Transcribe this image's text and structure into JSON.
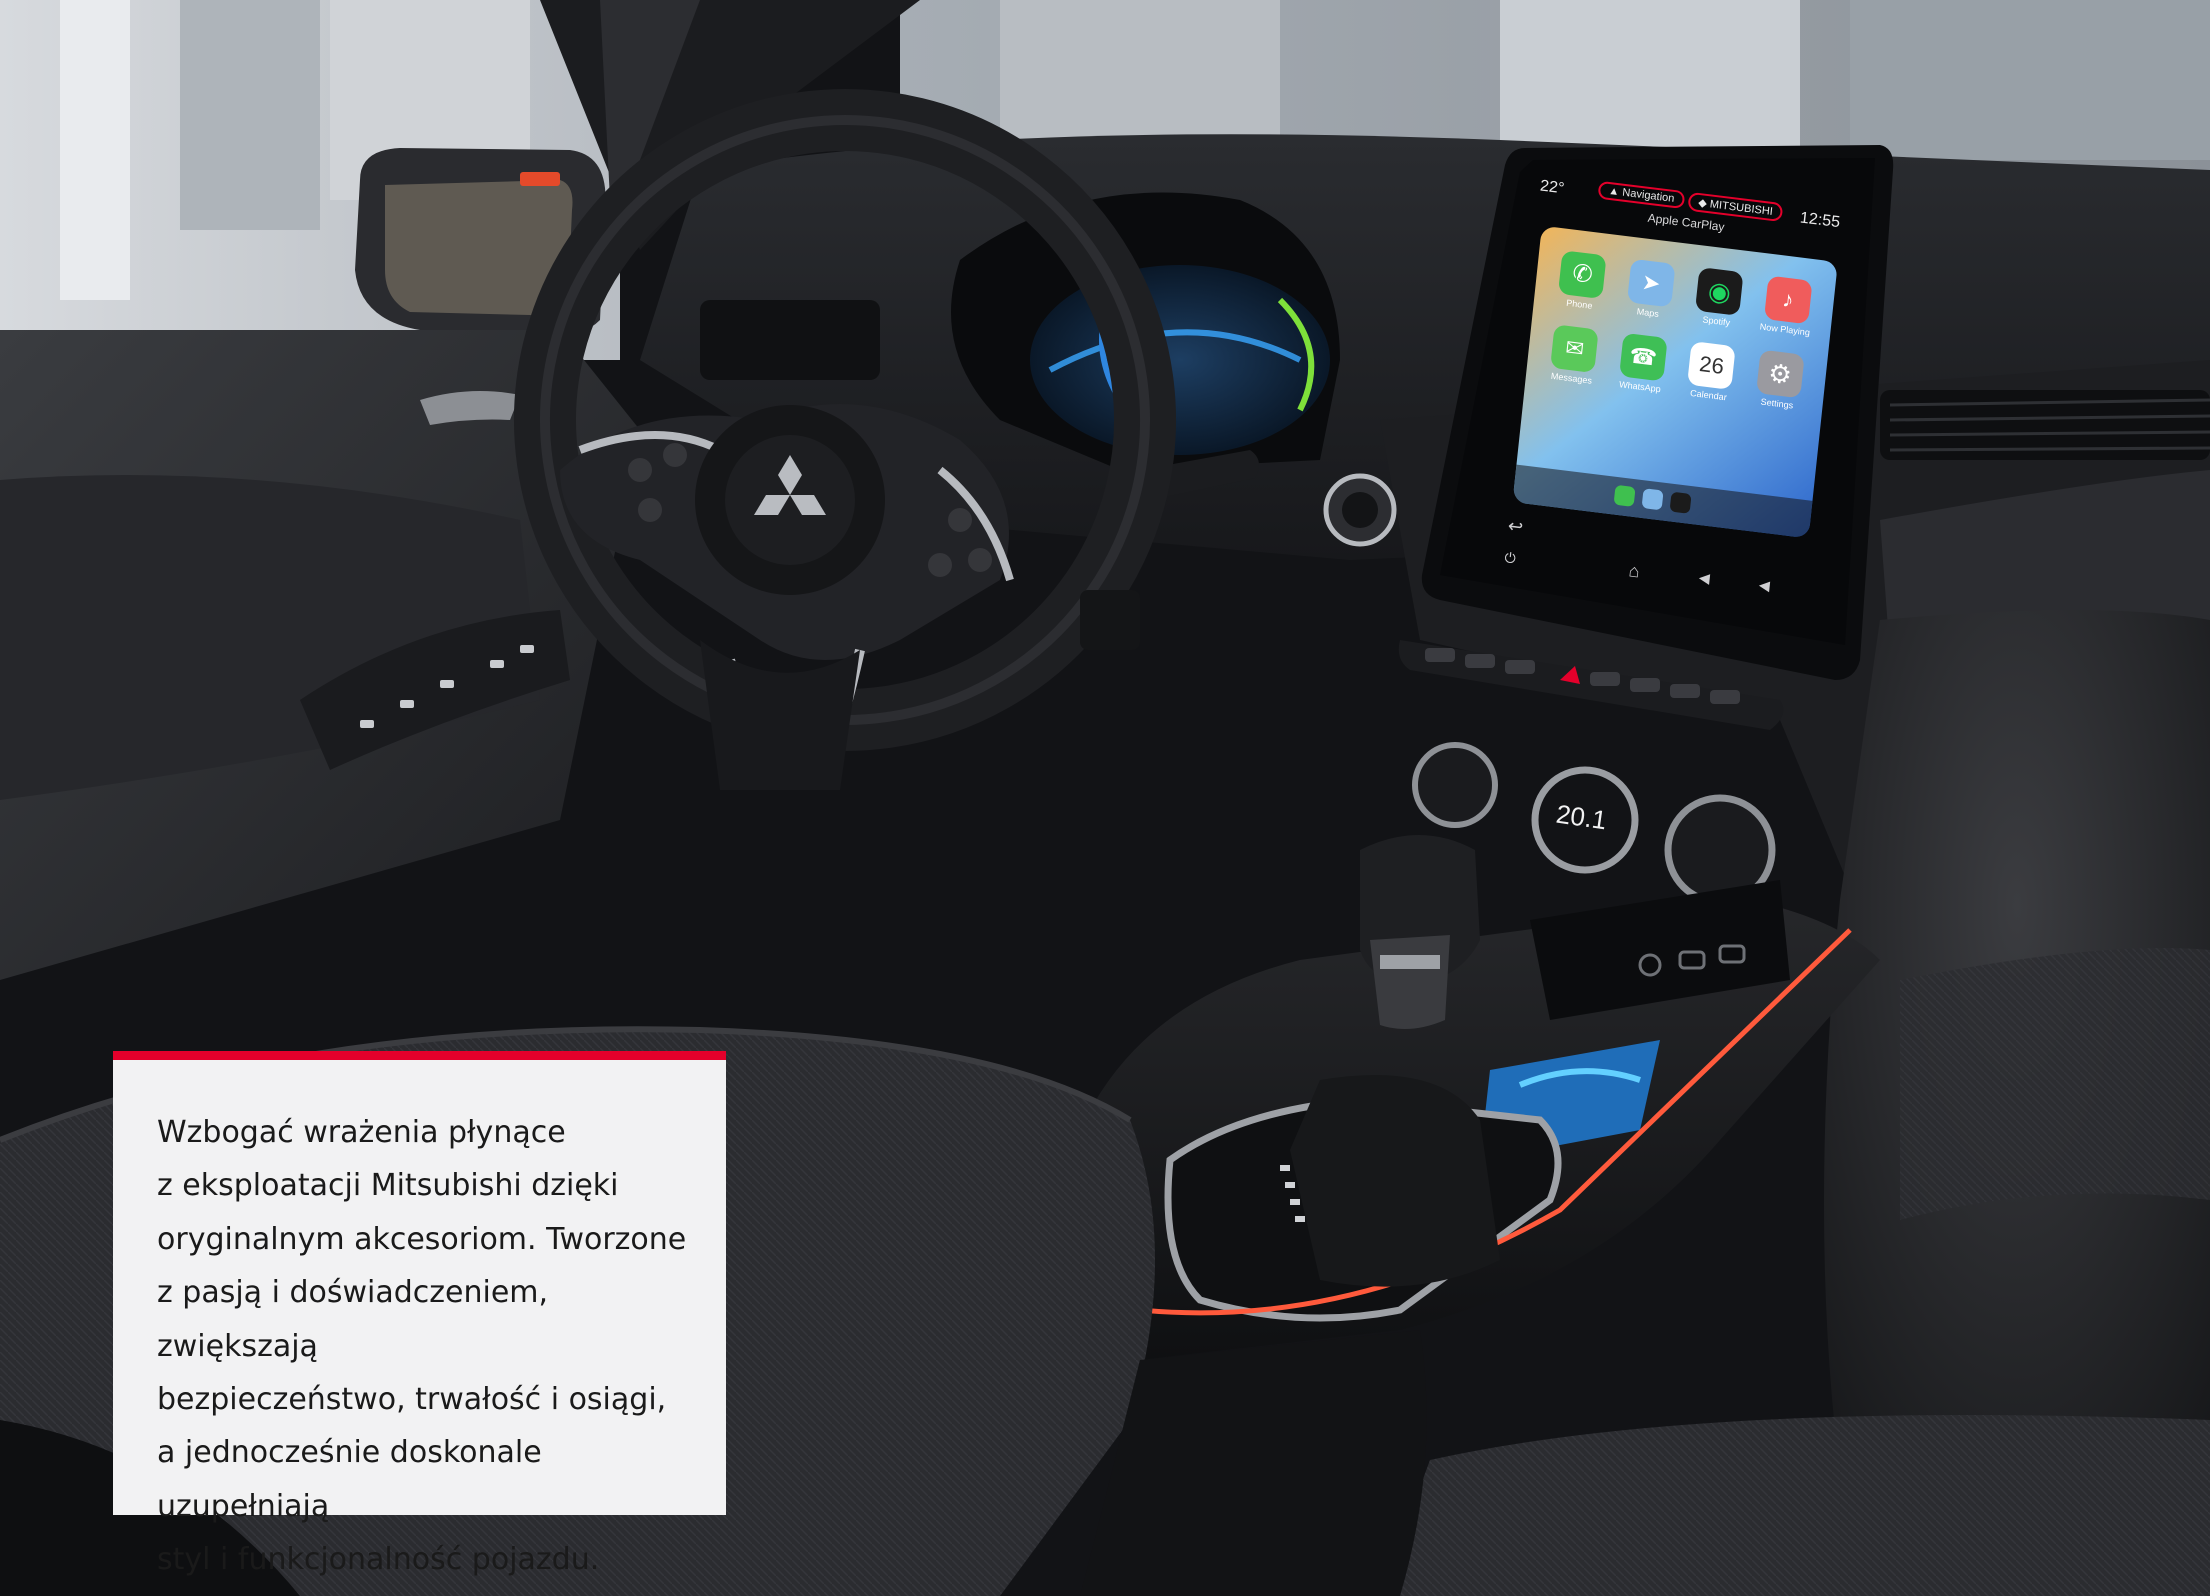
{
  "caption": {
    "lines": [
      "Wzbogać wrażenia płynące",
      "z eksploatacji Mitsubishi dzięki",
      "oryginalnym akcesoriom. Tworzone",
      "z pasją i doświadczeniem, zwiększają",
      "bezpieczeństwo, trwałość i osiągi,",
      "a jednocześnie doskonale uzupełniają",
      "styl i funkcjonalność pojazdu."
    ]
  },
  "screen": {
    "temperature": "22°",
    "nav_label": "Navigation",
    "brand_label": "MITSUBISHI",
    "clock": "12:55",
    "carplay_label": "Apple CarPlay",
    "apps": [
      {
        "label": "Phone",
        "color": "#3fc04f"
      },
      {
        "label": "Maps",
        "color": "#7fb6e8"
      },
      {
        "label": "Spotify",
        "color": "#1b1b1b"
      },
      {
        "label": "Now Playing",
        "color": "#f05c5c"
      },
      {
        "label": "Messages",
        "color": "#5ac95a"
      },
      {
        "label": "WhatsApp",
        "color": "#3fbf56"
      },
      {
        "label": "Calendar",
        "color": "#ffffff"
      },
      {
        "label": "Settings",
        "color": "#9a9aa0"
      }
    ],
    "calendar_day": "26"
  },
  "climate": {
    "temp_display": "20.1"
  },
  "colors": {
    "accent": "#e4002b",
    "panel": "#f2f2f3",
    "ambient": "#ff5a3c"
  }
}
